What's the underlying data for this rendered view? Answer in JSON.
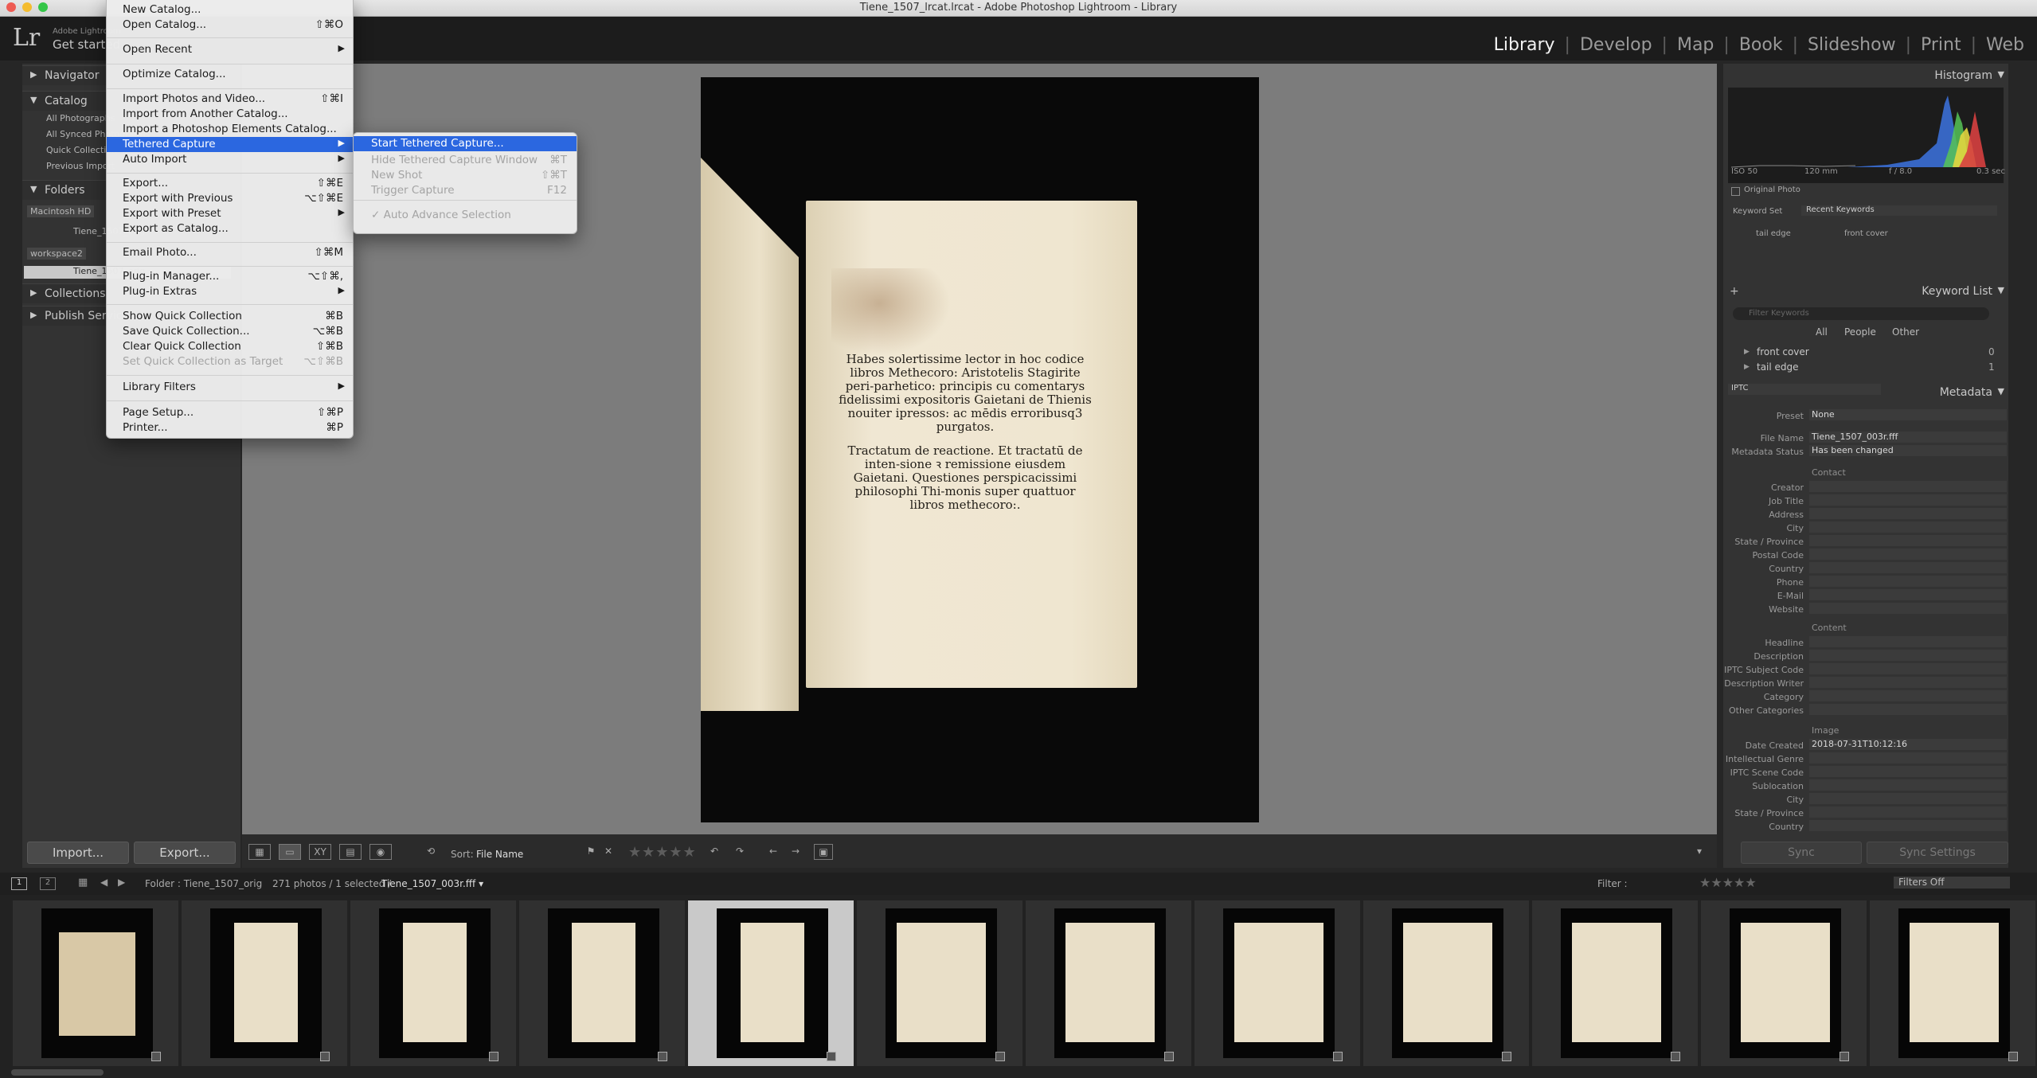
{
  "window": {
    "title": "Tiene_1507_lrcat.lrcat - Adobe Photoshop Lightroom - Library"
  },
  "identity": {
    "logo": "Lr",
    "line1": "Adobe Lightroom",
    "line2": "Get started"
  },
  "modules": [
    "Library",
    "Develop",
    "Map",
    "Book",
    "Slideshow",
    "Print",
    "Web"
  ],
  "module_separator": "|",
  "left_panel": {
    "navigator": "Navigator",
    "catalog": "Catalog",
    "catalog_items": [
      "All Photographs",
      "All Synced Photographs",
      "Quick Collection +",
      "Previous Import"
    ],
    "folders": "Folders",
    "volume1": "Macintosh HD",
    "folder1": "Tiene_1507_orig",
    "volume2": "workspace2",
    "folder2": "Tiene_1507_orig",
    "collections": "Collections",
    "publish": "Publish Services",
    "import_button": "Import...",
    "export_button": "Export..."
  },
  "file_menu": {
    "items": [
      {
        "label": "New Catalog...",
        "shortcut": ""
      },
      {
        "label": "Open Catalog...",
        "shortcut": "⇧⌘O"
      },
      {
        "label": "Open Recent",
        "shortcut": "▶"
      },
      {
        "label": "Optimize Catalog...",
        "shortcut": ""
      },
      {
        "label": "Import Photos and Video...",
        "shortcut": "⇧⌘I"
      },
      {
        "label": "Import from Another Catalog...",
        "shortcut": ""
      },
      {
        "label": "Import a Photoshop Elements Catalog...",
        "shortcut": ""
      },
      {
        "label": "Tethered Capture",
        "shortcut": "▶"
      },
      {
        "label": "Auto Import",
        "shortcut": "▶"
      },
      {
        "label": "Export...",
        "shortcut": "⇧⌘E"
      },
      {
        "label": "Export with Previous",
        "shortcut": "⌥⇧⌘E"
      },
      {
        "label": "Export with Preset",
        "shortcut": "▶"
      },
      {
        "label": "Export as Catalog...",
        "shortcut": ""
      },
      {
        "label": "Email Photo...",
        "shortcut": "⇧⌘M"
      },
      {
        "label": "Plug-in Manager...",
        "shortcut": "⌥⇧⌘,"
      },
      {
        "label": "Plug-in Extras",
        "shortcut": "▶"
      },
      {
        "label": "Show Quick Collection",
        "shortcut": "⌘B"
      },
      {
        "label": "Save Quick Collection...",
        "shortcut": "⌥⌘B"
      },
      {
        "label": "Clear Quick Collection",
        "shortcut": "⇧⌘B"
      },
      {
        "label": "Set Quick Collection as Target",
        "shortcut": "⌥⇧⌘B"
      },
      {
        "label": "Library Filters",
        "shortcut": "▶"
      },
      {
        "label": "Page Setup...",
        "shortcut": "⇧⌘P"
      },
      {
        "label": "Printer...",
        "shortcut": "⌘P"
      }
    ]
  },
  "tethered_submenu": {
    "items": [
      {
        "label": "Start Tethered Capture...",
        "shortcut": ""
      },
      {
        "label": "Hide Tethered Capture Window",
        "shortcut": "⌘T"
      },
      {
        "label": "New Shot",
        "shortcut": "⇧⌘T"
      },
      {
        "label": "Trigger Capture",
        "shortcut": "F12"
      },
      {
        "label": "✓ Auto Advance Selection",
        "shortcut": ""
      }
    ]
  },
  "document_text": [
    "Habes solertissime lector in hoc codice libros Methecoro: Aristotelis Stagirite peri-parhetico: principis cu comentarys fidelissimi expositoris Gaietani de Thienis nouiter ipressos: ac mēdis erroribusq3 purgatos.",
    "Tractatum de reactione. Et tractatū de inten-sione ꝛ remissione eiusdem Gaietani. Questiones perspicacissimi philosophi Thi-monis super quattuor libros methecoro:."
  ],
  "toolbar": {
    "sort_label": "Sort:",
    "sort_value": "File Name",
    "stars": "★★★★★"
  },
  "right_panel": {
    "histogram": "Histogram",
    "iso": "ISO 50",
    "focal": "120 mm",
    "aperture": "f / 8.0",
    "shutter": "0.3 sec",
    "original_photo": "Original Photo",
    "keyword_set_label": "Keyword Set",
    "keyword_set_value": "Recent Keywords",
    "recent_kw": [
      "tail edge",
      "front cover"
    ],
    "keyword_list": "Keyword List",
    "filter_placeholder": "Filter Keywords",
    "kw_tabs": [
      "All",
      "People",
      "Other"
    ],
    "keywords": [
      {
        "name": "front cover",
        "count": "0"
      },
      {
        "name": "tail edge",
        "count": "1"
      }
    ],
    "metadata": "Metadata",
    "metadata_set": "IPTC",
    "preset_label": "Preset",
    "preset_value": "None",
    "file_name_label": "File Name",
    "file_name": "Tiene_1507_003r.fff",
    "status_label": "Metadata Status",
    "status": "Has been changed",
    "contact": "Contact",
    "contact_fields": [
      "Creator",
      "Job Title",
      "Address",
      "City",
      "State / Province",
      "Postal Code",
      "Country",
      "Phone",
      "E-Mail",
      "Website"
    ],
    "content": "Content",
    "content_fields": [
      "Headline",
      "Description",
      "IPTC Subject Code",
      "Description Writer",
      "Category",
      "Other Categories"
    ],
    "image": "Image",
    "date_label": "Date Created",
    "date_value": "2018-07-31T10:12:16",
    "image_fields": [
      "Intellectual Genre",
      "IPTC Scene Code",
      "Sublocation",
      "City",
      "State / Province",
      "Country"
    ],
    "sync": "Sync",
    "sync_settings": "Sync Settings"
  },
  "filmstrip": {
    "page1": "1",
    "page2": "2",
    "source": "Folder : Tiene_1507_orig",
    "count": "271 photos / 1 selected /",
    "current": "Tiene_1507_003r.fff ▾",
    "filter_label": "Filter :",
    "filter_value": "Filters Off",
    "selected_index": 4
  }
}
